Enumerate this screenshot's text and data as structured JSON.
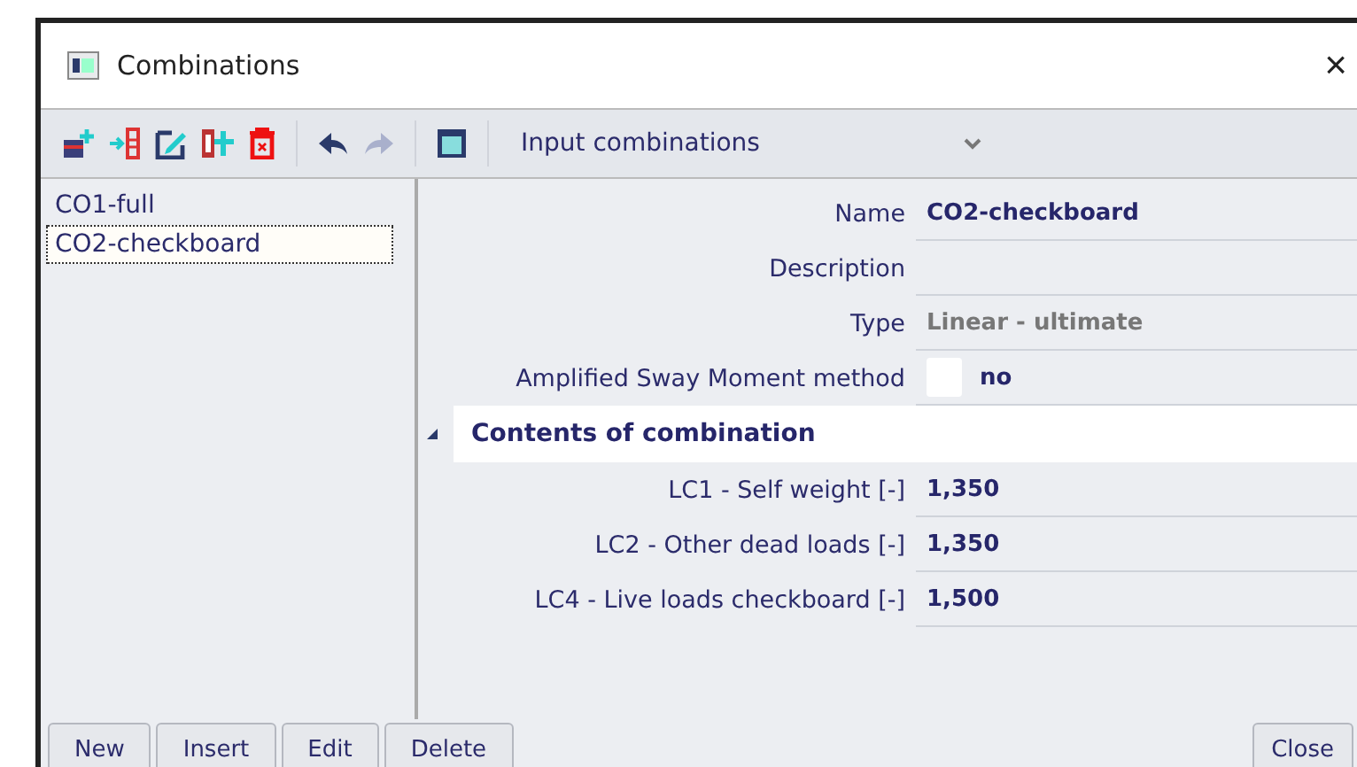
{
  "window": {
    "title": "Combinations",
    "close": "×"
  },
  "toolbar": {
    "view": "Input combinations"
  },
  "list": [
    {
      "label": "CO1-full",
      "selected": false
    },
    {
      "label": "CO2-checkboard",
      "selected": true
    }
  ],
  "properties": [
    {
      "kind": "text",
      "label": "Name",
      "value": "CO2-checkboard"
    },
    {
      "kind": "text",
      "label": "Description"
    },
    {
      "kind": "text",
      "label": "Type",
      "value": "Linear - ultimate",
      "disabled": true
    },
    {
      "kind": "checkbox",
      "label": "Amplified Sway Moment method",
      "checked": false,
      "value": "no"
    }
  ],
  "group": {
    "title": "Contents of combination",
    "expanded": true,
    "rows": [
      {
        "label": "LC1 - Self weight [-]",
        "value": "1,350"
      },
      {
        "label": "LC2 - Other dead loads [-]",
        "value": "1,350"
      },
      {
        "label": "LC4 - Live loads checkboard [-]",
        "value": "1,500"
      }
    ]
  },
  "buttons": [
    "New",
    "Insert",
    "Edit",
    "Delete"
  ],
  "close_button": "Close"
}
